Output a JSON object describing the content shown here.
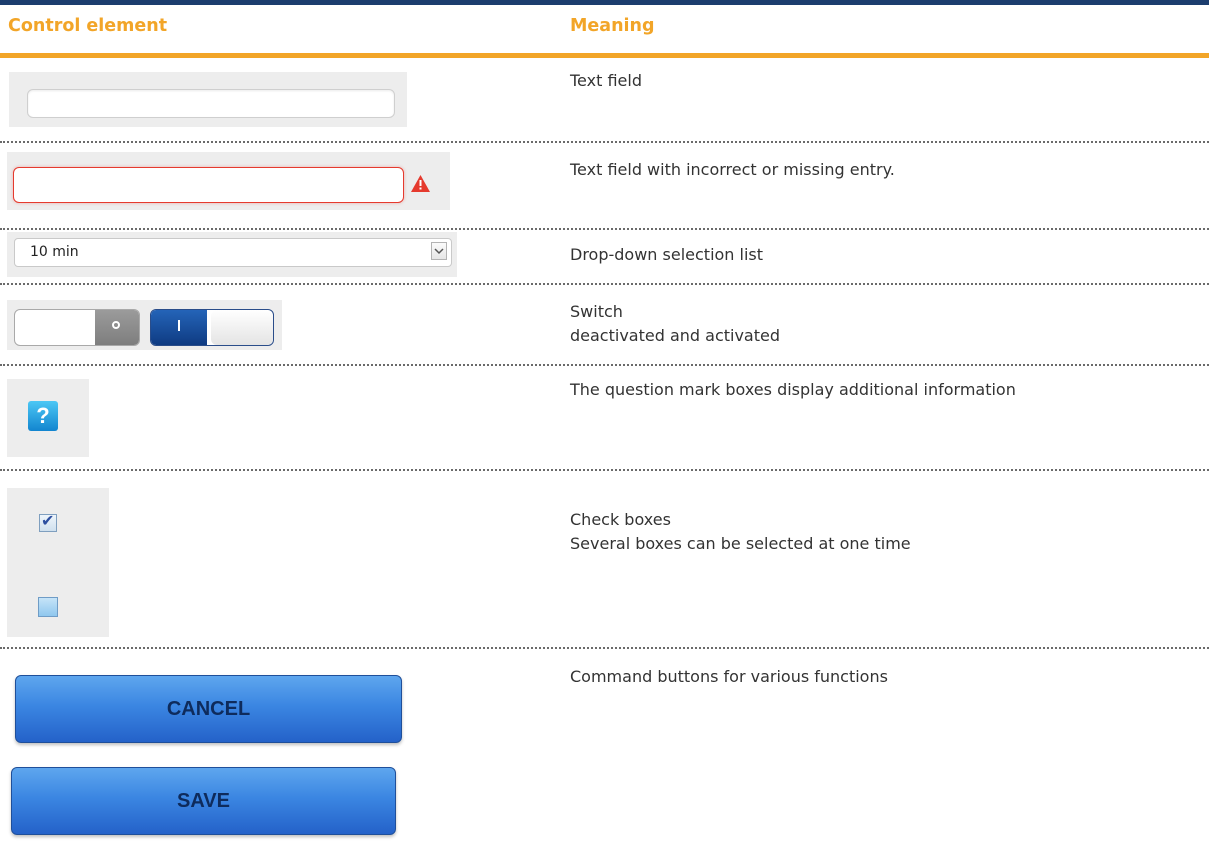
{
  "table": {
    "header": {
      "control": "Control element",
      "meaning": "Meaning"
    },
    "rows": [
      {
        "meaning": [
          "Text field"
        ]
      },
      {
        "meaning": [
          "Text field with incorrect or missing entry."
        ]
      },
      {
        "meaning": [
          "Drop-down selection list"
        ],
        "select_value": "10 min"
      },
      {
        "meaning": [
          "Switch",
          "deactivated and activated"
        ],
        "switch_off_glyph": "o",
        "switch_on_glyph": "I"
      },
      {
        "meaning": [
          "The question mark boxes display additional information"
        ],
        "help_glyph": "?"
      },
      {
        "meaning": [
          "Check boxes",
          "Several boxes can be selected at one time"
        ],
        "checkbox_1_checked": true,
        "checkbox_2_checked": false
      },
      {
        "meaning": [
          "Command buttons for various functions"
        ],
        "buttons": {
          "cancel": "CANCEL",
          "save": "SAVE"
        }
      }
    ]
  },
  "colors": {
    "top_bar": "#1c3d6e",
    "accent_orange": "#f2a528",
    "error_red": "#e53a2e",
    "switch_on_blue": "#0f3b82",
    "help_blue": "#1285cf",
    "button_blue": "#3b86e2"
  },
  "icons": {
    "warning": "warning-triangle-icon",
    "dropdown": "chevron-down-icon",
    "help": "question-mark-icon",
    "checkmark": "checkmark-icon"
  }
}
